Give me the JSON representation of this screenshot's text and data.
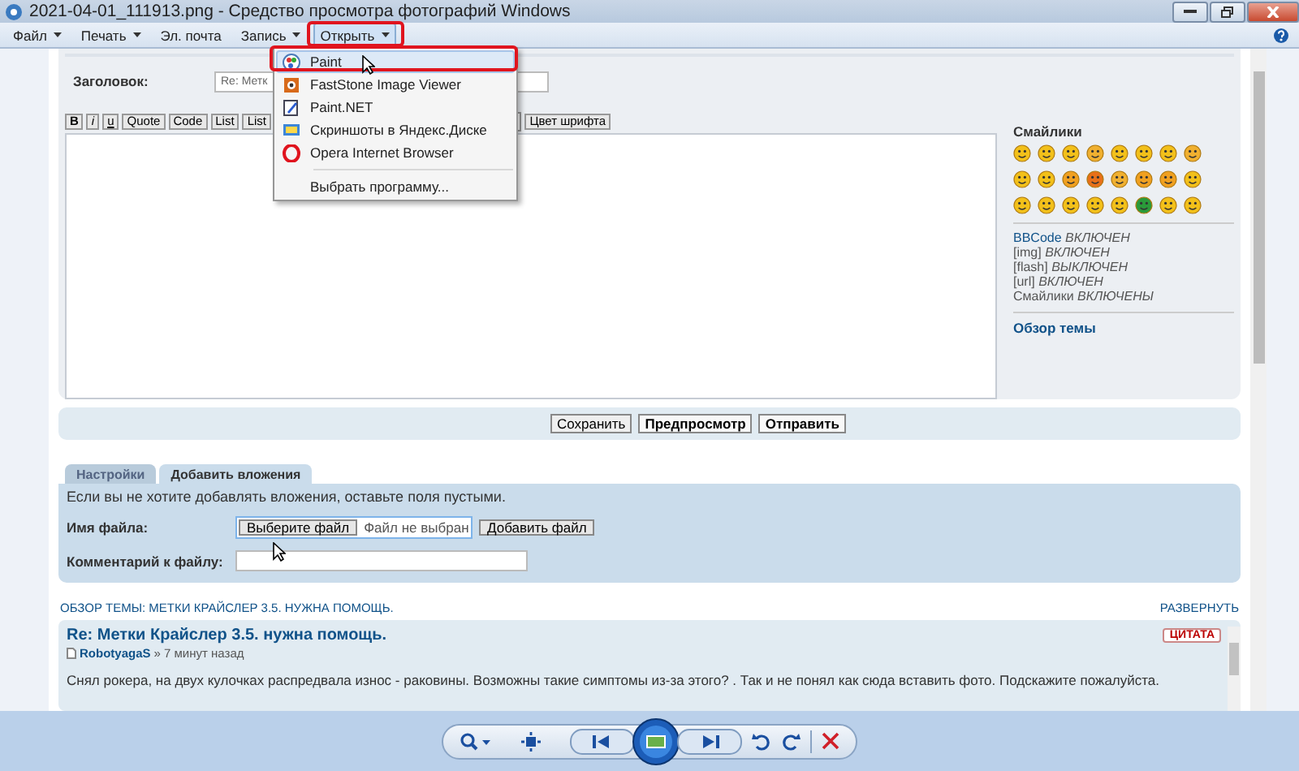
{
  "window": {
    "title": "2021-04-01_111913.png - Средство просмотра фотографий Windows"
  },
  "menu_bar": {
    "items": [
      {
        "label": "Файл",
        "dropdown": true,
        "expanded": false
      },
      {
        "label": "Печать",
        "dropdown": true,
        "expanded": false
      },
      {
        "label": "Эл. почта",
        "dropdown": false,
        "expanded": false
      },
      {
        "label": "Запись",
        "dropdown": true,
        "expanded": false
      },
      {
        "label": "Открыть",
        "dropdown": true,
        "expanded": true
      }
    ]
  },
  "open_menu": {
    "items": [
      {
        "label": "Paint",
        "selected": true,
        "separator_before": false
      },
      {
        "label": "FastStone Image Viewer",
        "selected": false,
        "separator_before": false
      },
      {
        "label": "Paint.NET",
        "selected": false,
        "separator_before": false
      },
      {
        "label": "Скриншоты в Яндекс.Диске",
        "selected": false,
        "separator_before": false
      },
      {
        "label": "Opera Internet Browser",
        "selected": false,
        "separator_before": false
      },
      {
        "label": "Выбрать программу...",
        "selected": false,
        "separator_before": true
      }
    ]
  },
  "page": {
    "subject_label": "Заголовок:",
    "subject_value": "Re: Метк",
    "format_buttons": [
      "B",
      "i",
      "u",
      "Quote",
      "Code",
      "List",
      "List"
    ],
    "color_button": "Цвет шрифта",
    "smilies_title": "Смайлики",
    "status_lines": [
      {
        "label": "BBCode",
        "status": "ВКЛЮЧЕН",
        "link": true
      },
      {
        "label": "[img]",
        "status": "ВКЛЮЧЕН",
        "link": false
      },
      {
        "label": "[flash]",
        "status": "ВЫКЛЮЧЕН",
        "link": false
      },
      {
        "label": "[url]",
        "status": "ВКЛЮЧЕН",
        "link": false
      },
      {
        "label": "Смайлики",
        "status": "ВКЛЮЧЕНЫ",
        "link": false
      }
    ],
    "topic_link": "Обзор темы",
    "actions": [
      {
        "label": "Сохранить",
        "emphasis": false
      },
      {
        "label": "Предпросмотр",
        "emphasis": true
      },
      {
        "label": "Отправить",
        "emphasis": true
      }
    ],
    "tabs": [
      {
        "label": "Настройки",
        "selected": false
      },
      {
        "label": "Добавить вложения",
        "selected": true
      }
    ],
    "attach": {
      "hint": "Если вы не хотите добавлять вложения, оставьте поля пустыми.",
      "file_label": "Имя файла:",
      "choose_button": "Выберите файл",
      "no_file": "Файл не выбран",
      "add_button": "Добавить файл",
      "comment_label": "Комментарий к файлу:"
    },
    "review": {
      "title": "ОБЗОР ТЕМЫ: МЕТКИ КРАЙСЛЕР 3.5. НУЖНА ПОМОЩЬ.",
      "expand": "РАЗВЕРНУТЬ",
      "post": {
        "title": "Re: Метки Крайслер 3.5. нужна помощь.",
        "author": "RobotyagaS",
        "time": "» 7 минут назад",
        "quote": "ЦИТАТА",
        "text": "Снял рокера, на двух кулочках распредвала износ - раковины. Возможны такие симптомы из-за этого? . Так и не понял как сюда вставить фото. Подскажите пожалуйста."
      }
    }
  }
}
